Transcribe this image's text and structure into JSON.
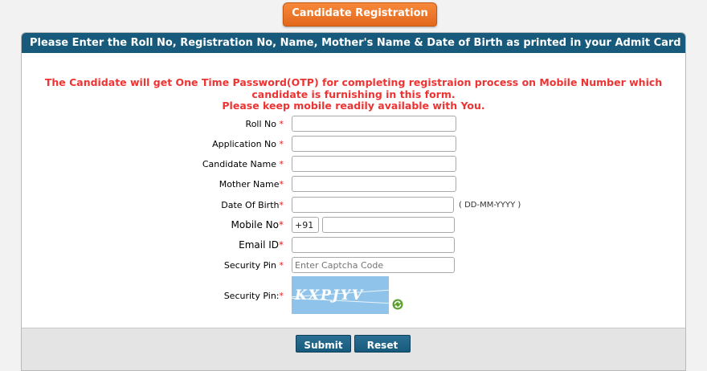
{
  "tab_title": "Candidate Registration",
  "panel_heading": "Please Enter the Roll No, Registration  No, Name, Mother's Name & Date of Birth as printed in your Admit Card",
  "notice": {
    "line1": "The Candidate will get One Time Password(OTP) for completing registraion process on Mobile Number which",
    "line2": "candidate is furnishing in this form.",
    "line3": "Please keep mobile readily available with You."
  },
  "fields": {
    "roll_no": {
      "label": "Roll No",
      "value": ""
    },
    "application_no": {
      "label": "Application No",
      "value": ""
    },
    "candidate_name": {
      "label": "Candidate Name",
      "value": ""
    },
    "mother_name": {
      "label": "Mother Name",
      "value": ""
    },
    "dob": {
      "label": "Date Of Birth",
      "value": "",
      "hint": "( DD-MM-YYYY )"
    },
    "mobile": {
      "label": "Mobile No",
      "prefix": "+91",
      "value": ""
    },
    "email": {
      "label": "Email ID",
      "value": ""
    },
    "security_pin": {
      "label": "Security Pin",
      "placeholder": "Enter Captcha Code",
      "value": ""
    },
    "captcha": {
      "label": "Security Pin:",
      "text": "KXPJYV"
    }
  },
  "required_mark": "*",
  "buttons": {
    "submit": "Submit",
    "reset": "Reset"
  },
  "colors": {
    "header": "#175a7c",
    "tab": "#e2671c",
    "notice": "#ee3333",
    "captcha_bg": "#8fc3ea"
  }
}
